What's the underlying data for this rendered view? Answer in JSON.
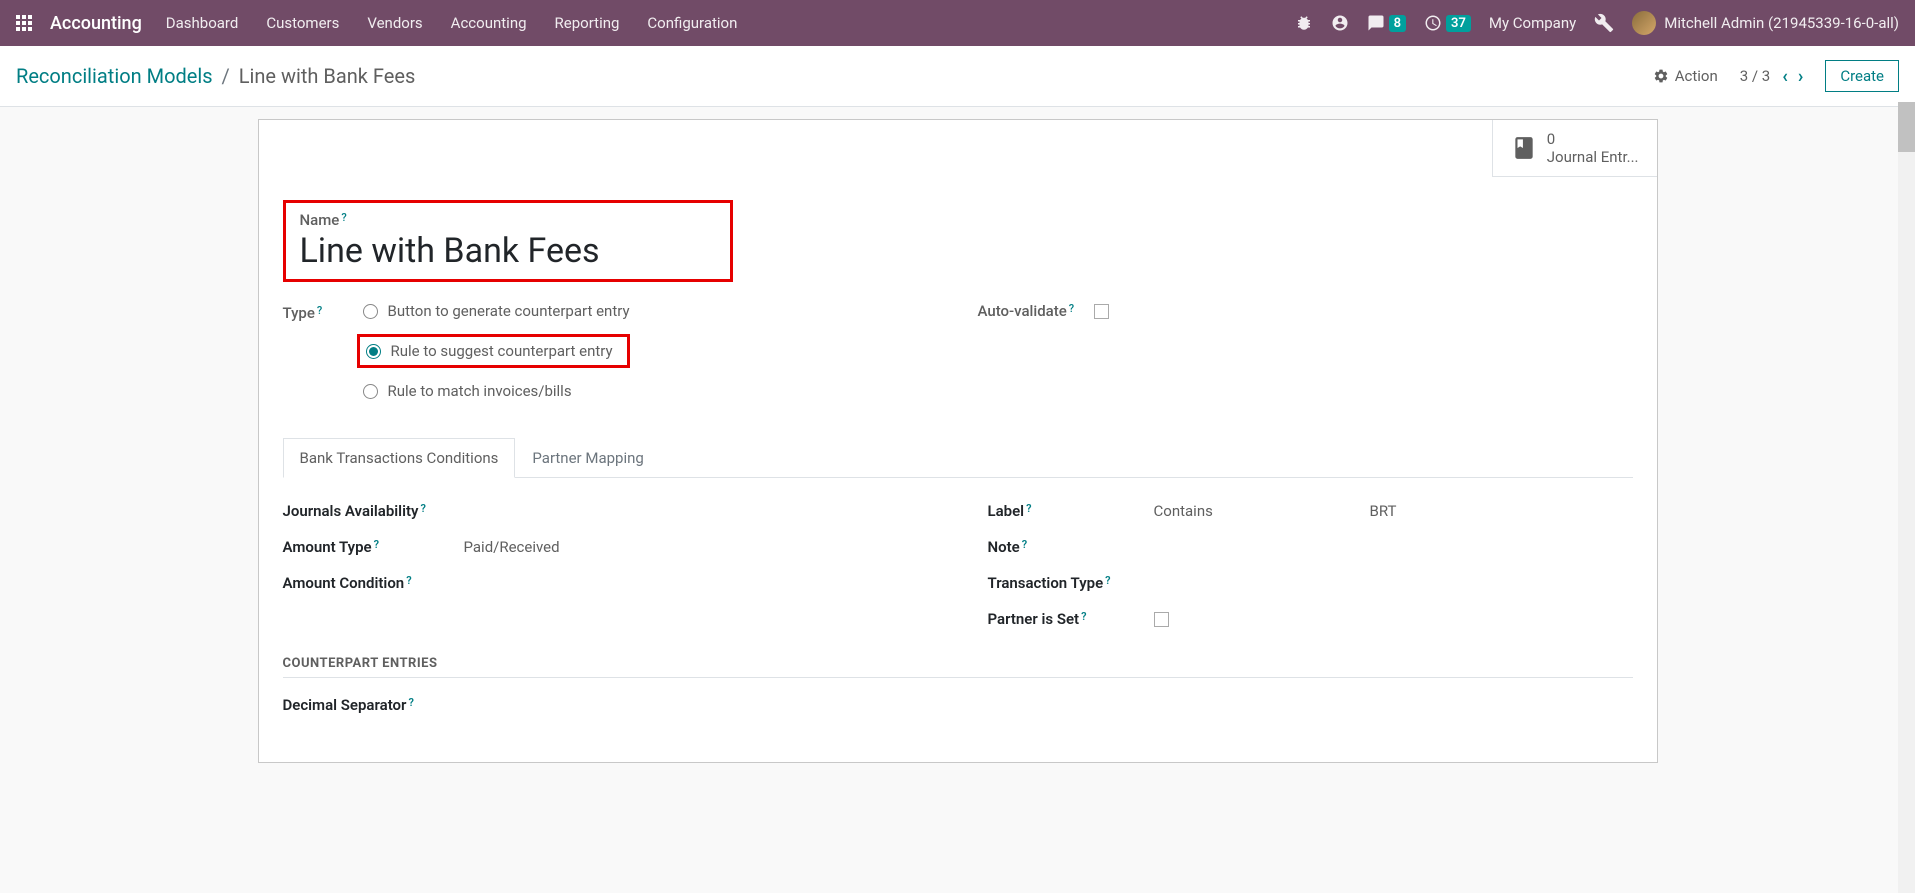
{
  "navbar": {
    "app_name": "Accounting",
    "menu": [
      "Dashboard",
      "Customers",
      "Vendors",
      "Accounting",
      "Reporting",
      "Configuration"
    ],
    "messages_badge": "8",
    "activities_badge": "37",
    "company": "My Company",
    "user": "Mitchell Admin (21945339-16-0-all)"
  },
  "breadcrumb": {
    "parent": "Reconciliation Models",
    "current": "Line with Bank Fees"
  },
  "controls": {
    "action": "Action",
    "pager": "3 / 3",
    "create": "Create"
  },
  "stat_button": {
    "value": "0",
    "label": "Journal Entr..."
  },
  "form": {
    "name_label": "Name",
    "name_value": "Line with Bank Fees",
    "type_label": "Type",
    "type_options": [
      "Button to generate counterpart entry",
      "Rule to suggest counterpart entry",
      "Rule to match invoices/bills"
    ],
    "auto_validate_label": "Auto-validate"
  },
  "tabs": {
    "tab1": "Bank Transactions Conditions",
    "tab2": "Partner Mapping"
  },
  "conditions": {
    "journals_label": "Journals Availability",
    "amount_type_label": "Amount Type",
    "amount_type_value": "Paid/Received",
    "amount_cond_label": "Amount Condition",
    "label_label": "Label",
    "label_op": "Contains",
    "label_value": "BRT",
    "note_label": "Note",
    "txn_type_label": "Transaction Type",
    "partner_set_label": "Partner is Set"
  },
  "counterpart": {
    "header": "COUNTERPART ENTRIES",
    "decimal_label": "Decimal Separator"
  }
}
